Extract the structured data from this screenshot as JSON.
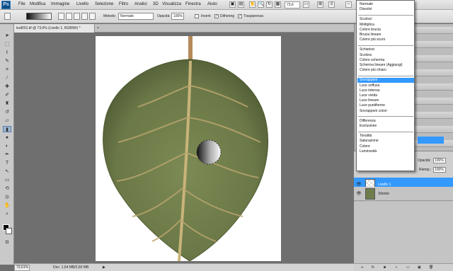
{
  "app": {
    "logo": "Ps"
  },
  "menubar": {
    "items": [
      "File",
      "Modifica",
      "Immagine",
      "Livello",
      "Selezione",
      "Filtro",
      "Analisi",
      "3D",
      "Visualizza",
      "Finestra",
      "Aiuto"
    ],
    "zoom": "73,6"
  },
  "options": {
    "mode_label": "Metodo:",
    "mode_value": "Normale",
    "opacity_label": "Opacità:",
    "opacity_value": "100%",
    "checkbox_inverti": "Inverti",
    "checkbox_dithering": "Dithering",
    "checkbox_trasparenza": "Trasparenza"
  },
  "document": {
    "tab_title": "leaf001.tif @ 73,6% (Livello 1, RGB/8#) *",
    "tab_close": "×"
  },
  "status": {
    "zoom": "73,61%",
    "doc_info": "Doc: 1,64 MB/2,60 MB"
  },
  "layers_panel": {
    "opacity_label": "Opacità:",
    "opacity_value": "100%",
    "fill_label": "Riemp.:",
    "fill_value": "100%",
    "layers": [
      {
        "name": "Livello 1",
        "selected": true
      },
      {
        "name": "Sfondo",
        "selected": false
      }
    ]
  },
  "blend_menu": {
    "groups": [
      [
        "Normale",
        "Dissolvi"
      ],
      [
        "Scurisci",
        "Moltiplica",
        "Colore brucia",
        "Brucia lineare",
        "Colore più scuro"
      ],
      [
        "Schiarisci",
        "Scolora",
        "Colore scherma",
        "Scherma lineare (Aggiungi)",
        "Colore più chiaro"
      ],
      [
        "Sovrapponi",
        "Luce soffusa",
        "Luce intensa",
        "Luce vivida",
        "Luce lineare",
        "Luce puntiforme",
        "Sovrapponi colori"
      ],
      [
        "Differenza",
        "Esclusione"
      ],
      [
        "Tonalità",
        "Saturazione",
        "Colore",
        "Luminosità"
      ]
    ],
    "selected": "Sovrapponi"
  },
  "colors": {
    "selection": "#3399ff",
    "leaf": "#6f7d4c",
    "vein": "#c9b47a"
  }
}
